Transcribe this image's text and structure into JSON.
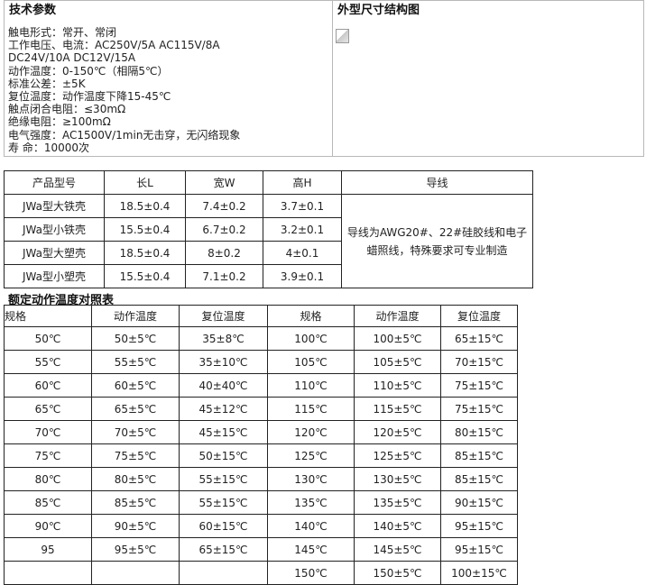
{
  "tech": {
    "title": "技术参数",
    "lines": [
      "触电形式：常开、常闭",
      "工作电压、电流：AC250V/5A AC115V/8A",
      "DC24V/10A DC12V/15A",
      "动作温度：0-150℃（相隔5℃）",
      "标准公差：±5K",
      "复位温度：动作温度下降15-45℃",
      "触点闭合电阻：≤30mΩ",
      "绝缘电阻：≥100mΩ",
      "电气强度：AC1500V/1min无击穿，无闪络现象",
      "寿 命：10000次"
    ]
  },
  "outline": {
    "title": "外型尺寸结构图"
  },
  "dimensions": {
    "headers": [
      "产品型号",
      "长L",
      "宽W",
      "高H",
      "导线"
    ],
    "rows": [
      [
        "JWa型大铁壳",
        "18.5±0.4",
        "7.4±0.2",
        "3.7±0.1"
      ],
      [
        "JWa型小铁壳",
        "15.5±0.4",
        "6.7±0.2",
        "3.2±0.1"
      ],
      [
        "JWa型大塑壳",
        "18.5±0.4",
        "8±0.2",
        "4±0.1"
      ],
      [
        "JWa型小塑壳",
        "15.5±0.4",
        "7.1±0.2",
        "3.9±0.1"
      ]
    ],
    "wire_note": "导线为AWG20#、22#硅胶线和电子蜡照线，特殊要求可专业制造"
  },
  "rated": {
    "title": "额定动作温度对照表",
    "headers": [
      "规格",
      "动作温度",
      "复位温度",
      "规格",
      "动作温度",
      "复位温度"
    ],
    "rows": [
      [
        "50℃",
        "50±5℃",
        "35±8℃",
        "100℃",
        "100±5℃",
        "65±15℃"
      ],
      [
        "55℃",
        "55±5℃",
        "35±10℃",
        "105℃",
        "105±5℃",
        "70±15℃"
      ],
      [
        "60℃",
        "60±5℃",
        "40±40℃",
        "110℃",
        "110±5℃",
        "75±15℃"
      ],
      [
        "65℃",
        "65±5℃",
        "45±12℃",
        "115℃",
        "115±5℃",
        "75±15℃"
      ],
      [
        "70℃",
        "70±5℃",
        "45±15℃",
        "120℃",
        "120±5℃",
        "80±15℃"
      ],
      [
        "75℃",
        "75±5℃",
        "50±15℃",
        "125℃",
        "125±5℃",
        "85±15℃"
      ],
      [
        "80℃",
        "80±5℃",
        "55±15℃",
        "130℃",
        "130±5℃",
        "85±15℃"
      ],
      [
        "85℃",
        "85±5℃",
        "55±15℃",
        "135℃",
        "135±5℃",
        "90±15℃"
      ],
      [
        "90℃",
        "90±5℃",
        "60±15℃",
        "140℃",
        "140±5℃",
        "95±15℃"
      ],
      [
        "95",
        "95±5℃",
        "65±15℃",
        "145℃",
        "145±5℃",
        "95±15℃"
      ],
      [
        "",
        "",
        "",
        "150℃",
        "150±5℃",
        "100±15℃"
      ]
    ]
  }
}
